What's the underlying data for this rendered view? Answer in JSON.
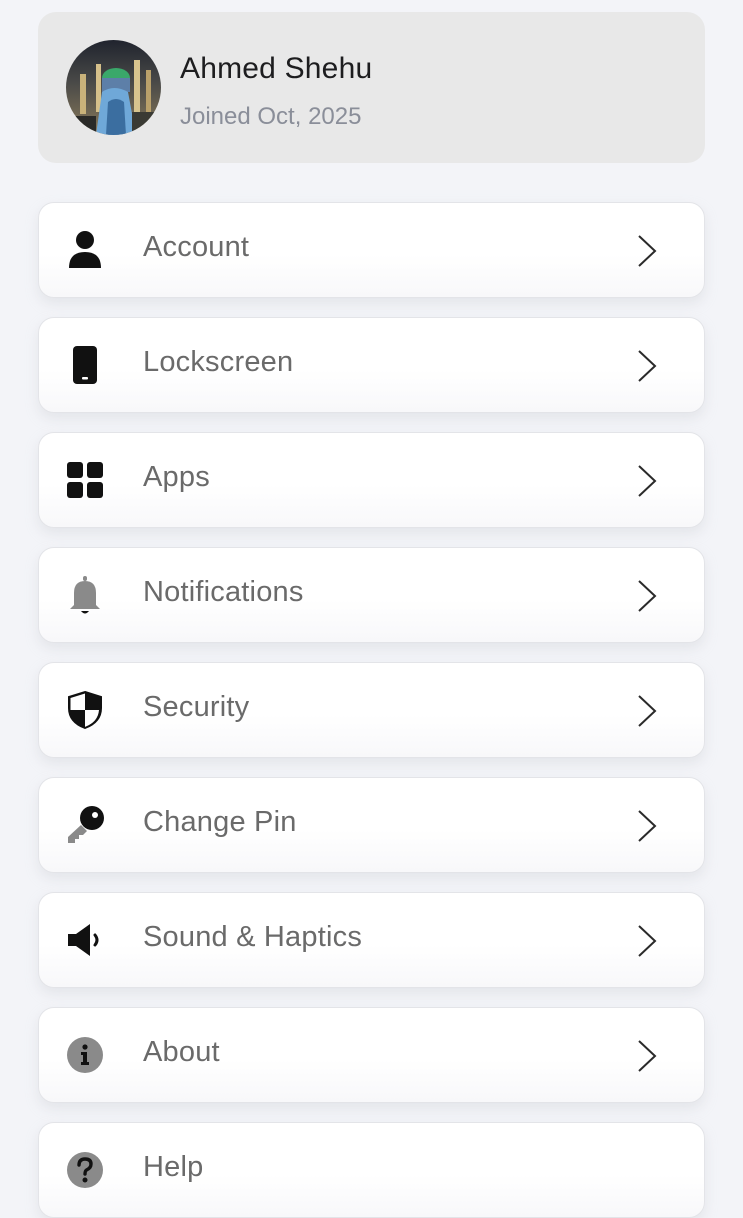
{
  "profile": {
    "name": "Ahmed Shehu",
    "joined": "Joined Oct, 2025"
  },
  "menu": {
    "items": [
      {
        "label": "Account",
        "icon": "person-icon"
      },
      {
        "label": "Lockscreen",
        "icon": "phone-icon"
      },
      {
        "label": "Apps",
        "icon": "grid-icon"
      },
      {
        "label": "Notifications",
        "icon": "bell-icon"
      },
      {
        "label": "Security",
        "icon": "shield-icon"
      },
      {
        "label": "Change Pin",
        "icon": "key-icon"
      },
      {
        "label": "Sound & Haptics",
        "icon": "speaker-icon"
      },
      {
        "label": "About",
        "icon": "info-icon"
      },
      {
        "label": "Help",
        "icon": "help-icon"
      }
    ]
  },
  "colors": {
    "background": "#f3f4f8",
    "profile_card": "#e8e8e8",
    "card": "#ffffff",
    "label_text": "#6a6a6a",
    "icon_dark": "#111111",
    "icon_gray": "#8a8a8a"
  }
}
